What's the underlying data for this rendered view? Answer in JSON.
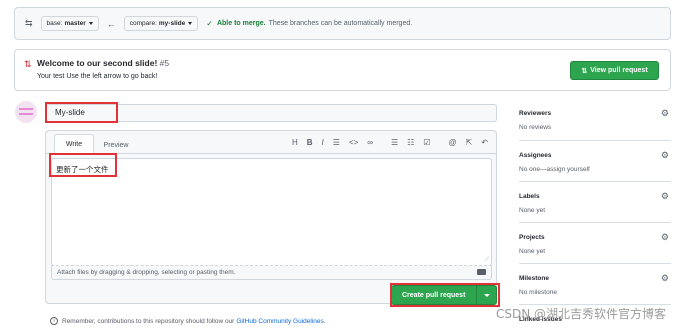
{
  "compare": {
    "base_prefix": "base:",
    "base_branch": "master",
    "compare_prefix": "compare:",
    "compare_branch": "my-slide",
    "merge_status": "Able to merge.",
    "merge_detail": "These branches can be automatically merged."
  },
  "notice": {
    "title": "Welcome to our second slide!",
    "number": "#5",
    "subtitle": "Your test Use the left arrow to go back!",
    "view_button": "View pull request"
  },
  "form": {
    "title_value": "My-slide",
    "tab_write": "Write",
    "tab_preview": "Preview",
    "body_value": "更新了一个文件",
    "attach_hint": "Attach files by dragging & dropping, selecting or pasting them.",
    "create_button": "Create pull request"
  },
  "toolbar": {
    "heading": "H",
    "bold": "B",
    "italic": "I",
    "quote": "☰",
    "code": "<>",
    "link": "🔗",
    "ul": "☰",
    "ol": "☷",
    "task": "☑",
    "mention": "@",
    "reference": "⇱",
    "reply": "↶"
  },
  "remember": {
    "text": "Remember, contributions to this repository should follow our",
    "link": "GitHub Community Guidelines",
    "end": "."
  },
  "sidebar": {
    "reviewers_title": "Reviewers",
    "reviewers_value": "No reviews",
    "assignees_title": "Assignees",
    "assignees_value": "No one—assign yourself",
    "labels_title": "Labels",
    "labels_value": "None yet",
    "projects_title": "Projects",
    "projects_value": "None yet",
    "milestone_title": "Milestone",
    "milestone_value": "No milestone",
    "linked_title": "Linked issues"
  },
  "watermark": "CSDN @湖北吉秀软件官方博客",
  "colors": {
    "green": "#2da44e",
    "highlight_red": "#e13238",
    "link_blue": "#0969da"
  }
}
